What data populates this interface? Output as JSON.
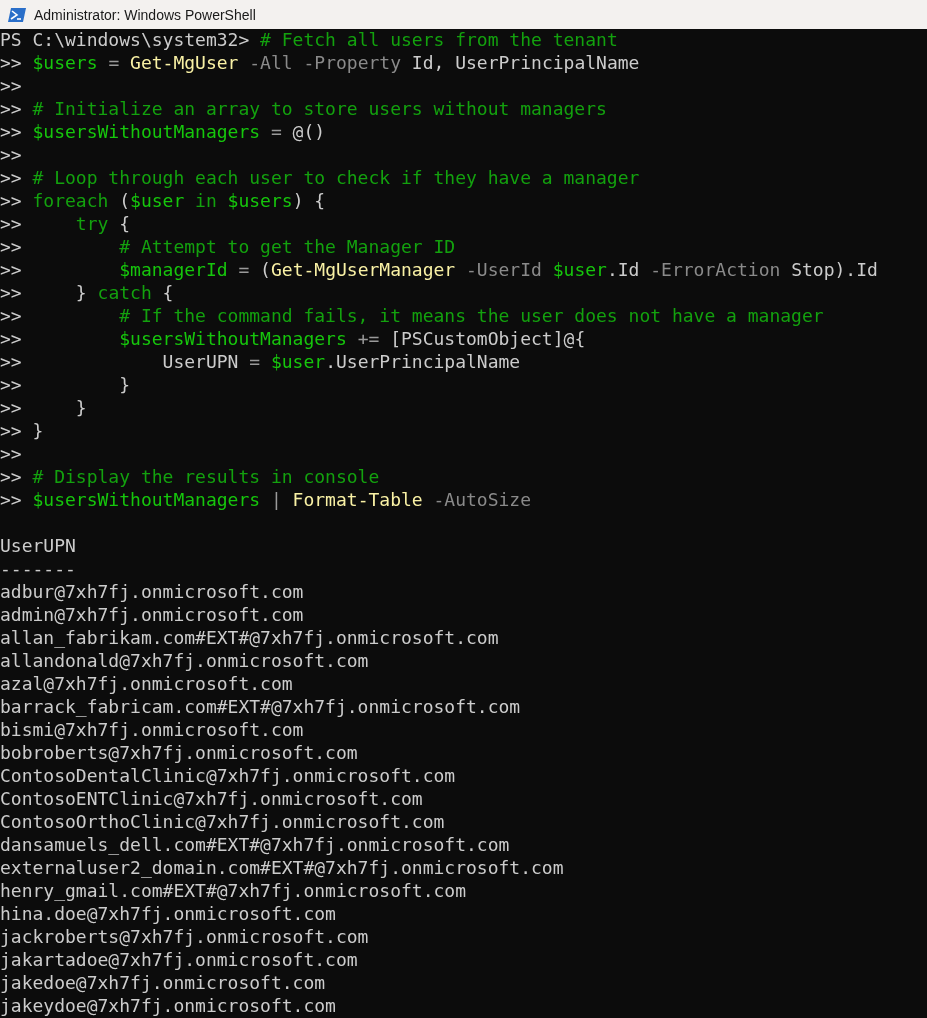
{
  "window": {
    "title": "Administrator: Windows PowerShell"
  },
  "console": {
    "lines": [
      {
        "kind": "code",
        "tokens": [
          {
            "kind": "prompt",
            "text": "PS C:\\windows\\system32> "
          },
          {
            "kind": "comment",
            "text": "# Fetch all users from the tenant"
          }
        ]
      },
      {
        "kind": "code",
        "tokens": [
          {
            "kind": "prompt",
            "text": ">> "
          },
          {
            "kind": "variable",
            "text": "$users"
          },
          {
            "kind": "operator",
            "text": " = "
          },
          {
            "kind": "command",
            "text": "Get-MgUser"
          },
          {
            "kind": "parameter",
            "text": " -All -Property"
          },
          {
            "kind": "text",
            "text": " Id, UserPrincipalName"
          }
        ]
      },
      {
        "kind": "code",
        "tokens": [
          {
            "kind": "prompt",
            "text": ">>"
          }
        ]
      },
      {
        "kind": "code",
        "tokens": [
          {
            "kind": "prompt",
            "text": ">> "
          },
          {
            "kind": "comment",
            "text": "# Initialize an array to store users without managers"
          }
        ]
      },
      {
        "kind": "code",
        "tokens": [
          {
            "kind": "prompt",
            "text": ">> "
          },
          {
            "kind": "variable",
            "text": "$usersWithoutManagers"
          },
          {
            "kind": "operator",
            "text": " = "
          },
          {
            "kind": "text",
            "text": "@()"
          }
        ]
      },
      {
        "kind": "code",
        "tokens": [
          {
            "kind": "prompt",
            "text": ">>"
          }
        ]
      },
      {
        "kind": "code",
        "tokens": [
          {
            "kind": "prompt",
            "text": ">> "
          },
          {
            "kind": "comment",
            "text": "# Loop through each user to check if they have a manager"
          }
        ]
      },
      {
        "kind": "code",
        "tokens": [
          {
            "kind": "prompt",
            "text": ">> "
          },
          {
            "kind": "keyword",
            "text": "foreach"
          },
          {
            "kind": "text",
            "text": " ("
          },
          {
            "kind": "variable",
            "text": "$user"
          },
          {
            "kind": "keyword",
            "text": " in "
          },
          {
            "kind": "variable",
            "text": "$users"
          },
          {
            "kind": "text",
            "text": ") {"
          }
        ]
      },
      {
        "kind": "code",
        "tokens": [
          {
            "kind": "prompt",
            "text": ">> "
          },
          {
            "kind": "keyword",
            "text": "    try"
          },
          {
            "kind": "text",
            "text": " {"
          }
        ]
      },
      {
        "kind": "code",
        "tokens": [
          {
            "kind": "prompt",
            "text": ">> "
          },
          {
            "kind": "comment",
            "text": "        # Attempt to get the Manager ID"
          }
        ]
      },
      {
        "kind": "code",
        "tokens": [
          {
            "kind": "prompt",
            "text": ">> "
          },
          {
            "kind": "variable",
            "text": "        $managerId"
          },
          {
            "kind": "operator",
            "text": " = "
          },
          {
            "kind": "text",
            "text": "("
          },
          {
            "kind": "command",
            "text": "Get-MgUserManager"
          },
          {
            "kind": "parameter",
            "text": " -UserId "
          },
          {
            "kind": "variable",
            "text": "$user"
          },
          {
            "kind": "text",
            "text": ".Id"
          },
          {
            "kind": "parameter",
            "text": " -ErrorAction"
          },
          {
            "kind": "text",
            "text": " Stop).Id"
          }
        ]
      },
      {
        "kind": "code",
        "tokens": [
          {
            "kind": "prompt",
            "text": ">> "
          },
          {
            "kind": "text",
            "text": "    } "
          },
          {
            "kind": "keyword",
            "text": "catch"
          },
          {
            "kind": "text",
            "text": " {"
          }
        ]
      },
      {
        "kind": "code",
        "tokens": [
          {
            "kind": "prompt",
            "text": ">> "
          },
          {
            "kind": "comment",
            "text": "        # If the command fails, it means the user does not have a manager"
          }
        ]
      },
      {
        "kind": "code",
        "tokens": [
          {
            "kind": "prompt",
            "text": ">> "
          },
          {
            "kind": "variable",
            "text": "        $usersWithoutManagers"
          },
          {
            "kind": "operator",
            "text": " += "
          },
          {
            "kind": "text",
            "text": "[PSCustomObject]@{"
          }
        ]
      },
      {
        "kind": "code",
        "tokens": [
          {
            "kind": "prompt",
            "text": ">> "
          },
          {
            "kind": "text",
            "text": "            UserUPN"
          },
          {
            "kind": "operator",
            "text": " = "
          },
          {
            "kind": "variable",
            "text": "$user"
          },
          {
            "kind": "text",
            "text": ".UserPrincipalName"
          }
        ]
      },
      {
        "kind": "code",
        "tokens": [
          {
            "kind": "prompt",
            "text": ">> "
          },
          {
            "kind": "text",
            "text": "        }"
          }
        ]
      },
      {
        "kind": "code",
        "tokens": [
          {
            "kind": "prompt",
            "text": ">> "
          },
          {
            "kind": "text",
            "text": "    }"
          }
        ]
      },
      {
        "kind": "code",
        "tokens": [
          {
            "kind": "prompt",
            "text": ">> "
          },
          {
            "kind": "text",
            "text": "}"
          }
        ]
      },
      {
        "kind": "code",
        "tokens": [
          {
            "kind": "prompt",
            "text": ">>"
          }
        ]
      },
      {
        "kind": "code",
        "tokens": [
          {
            "kind": "prompt",
            "text": ">> "
          },
          {
            "kind": "comment",
            "text": "# Display the results in console"
          }
        ]
      },
      {
        "kind": "code",
        "tokens": [
          {
            "kind": "prompt",
            "text": ">> "
          },
          {
            "kind": "variable",
            "text": "$usersWithoutManagers"
          },
          {
            "kind": "operator",
            "text": " | "
          },
          {
            "kind": "command",
            "text": "Format-Table"
          },
          {
            "kind": "parameter",
            "text": " -AutoSize"
          }
        ]
      },
      {
        "kind": "blank"
      },
      {
        "kind": "code",
        "tokens": [
          {
            "kind": "text",
            "text": "UserUPN"
          }
        ]
      },
      {
        "kind": "code",
        "tokens": [
          {
            "kind": "text",
            "text": "-------"
          }
        ]
      },
      {
        "kind": "code",
        "tokens": [
          {
            "kind": "text",
            "text": "adbur@7xh7fj.onmicrosoft.com"
          }
        ]
      },
      {
        "kind": "code",
        "tokens": [
          {
            "kind": "text",
            "text": "admin@7xh7fj.onmicrosoft.com"
          }
        ]
      },
      {
        "kind": "code",
        "tokens": [
          {
            "kind": "text",
            "text": "allan_fabrikam.com#EXT#@7xh7fj.onmicrosoft.com"
          }
        ]
      },
      {
        "kind": "code",
        "tokens": [
          {
            "kind": "text",
            "text": "allandonald@7xh7fj.onmicrosoft.com"
          }
        ]
      },
      {
        "kind": "code",
        "tokens": [
          {
            "kind": "text",
            "text": "azal@7xh7fj.onmicrosoft.com"
          }
        ]
      },
      {
        "kind": "code",
        "tokens": [
          {
            "kind": "text",
            "text": "barrack_fabricam.com#EXT#@7xh7fj.onmicrosoft.com"
          }
        ]
      },
      {
        "kind": "code",
        "tokens": [
          {
            "kind": "text",
            "text": "bismi@7xh7fj.onmicrosoft.com"
          }
        ]
      },
      {
        "kind": "code",
        "tokens": [
          {
            "kind": "text",
            "text": "bobroberts@7xh7fj.onmicrosoft.com"
          }
        ]
      },
      {
        "kind": "code",
        "tokens": [
          {
            "kind": "text",
            "text": "ContosoDentalClinic@7xh7fj.onmicrosoft.com"
          }
        ]
      },
      {
        "kind": "code",
        "tokens": [
          {
            "kind": "text",
            "text": "ContosoENTClinic@7xh7fj.onmicrosoft.com"
          }
        ]
      },
      {
        "kind": "code",
        "tokens": [
          {
            "kind": "text",
            "text": "ContosoOrthoClinic@7xh7fj.onmicrosoft.com"
          }
        ]
      },
      {
        "kind": "code",
        "tokens": [
          {
            "kind": "text",
            "text": "dansamuels_dell.com#EXT#@7xh7fj.onmicrosoft.com"
          }
        ]
      },
      {
        "kind": "code",
        "tokens": [
          {
            "kind": "text",
            "text": "externaluser2_domain.com#EXT#@7xh7fj.onmicrosoft.com"
          }
        ]
      },
      {
        "kind": "code",
        "tokens": [
          {
            "kind": "text",
            "text": "henry_gmail.com#EXT#@7xh7fj.onmicrosoft.com"
          }
        ]
      },
      {
        "kind": "code",
        "tokens": [
          {
            "kind": "text",
            "text": "hina.doe@7xh7fj.onmicrosoft.com"
          }
        ]
      },
      {
        "kind": "code",
        "tokens": [
          {
            "kind": "text",
            "text": "jackroberts@7xh7fj.onmicrosoft.com"
          }
        ]
      },
      {
        "kind": "code",
        "tokens": [
          {
            "kind": "text",
            "text": "jakartadoe@7xh7fj.onmicrosoft.com"
          }
        ]
      },
      {
        "kind": "code",
        "tokens": [
          {
            "kind": "text",
            "text": "jakedoe@7xh7fj.onmicrosoft.com"
          }
        ]
      },
      {
        "kind": "code",
        "tokens": [
          {
            "kind": "text",
            "text": "jakeydoe@7xh7fj.onmicrosoft.com"
          }
        ]
      }
    ]
  }
}
